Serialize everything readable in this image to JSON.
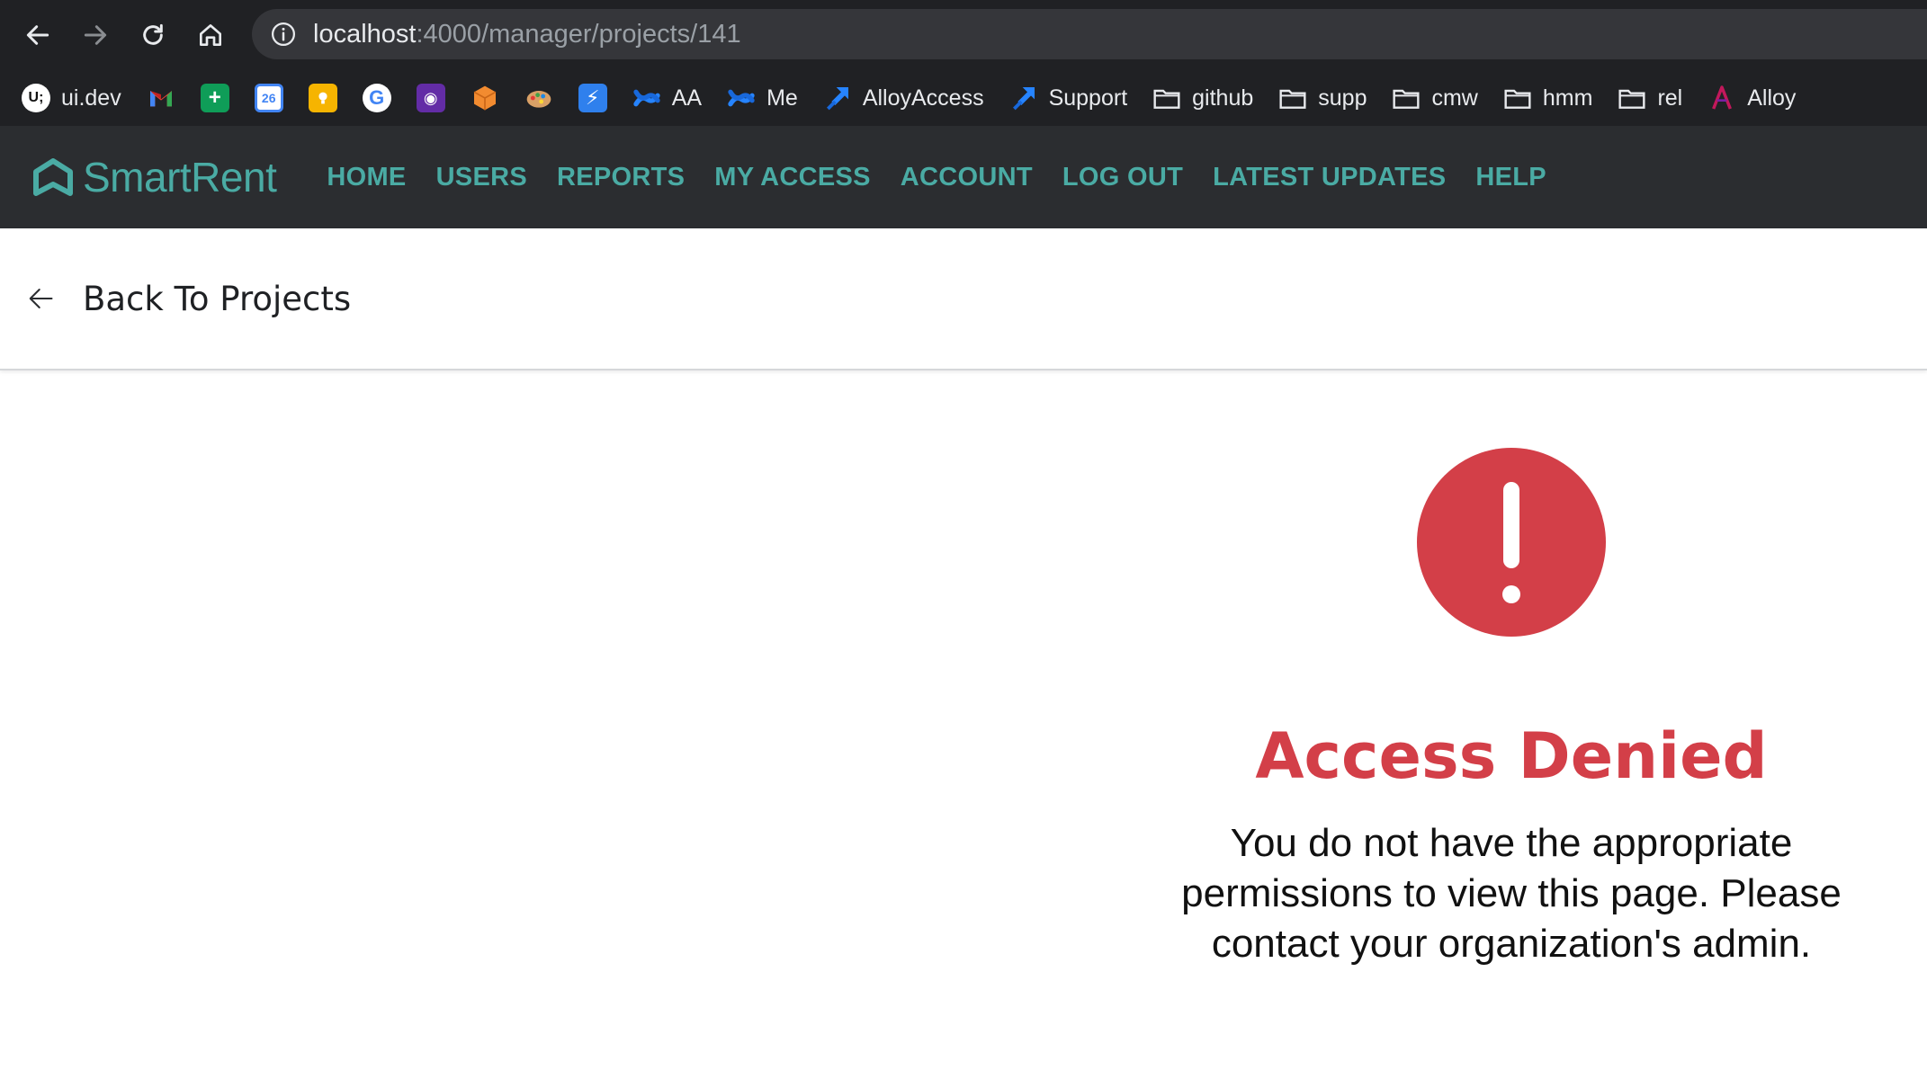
{
  "browser": {
    "url_host": "localhost",
    "url_path": ":4000/manager/projects/141",
    "bookmarks": [
      {
        "label": "ui.dev",
        "icon": "ui-dev-icon"
      },
      {
        "label": "",
        "icon": "gmail-icon"
      },
      {
        "label": "",
        "icon": "sheets-icon"
      },
      {
        "label": "",
        "icon": "calendar-icon",
        "icon_text": "26"
      },
      {
        "label": "",
        "icon": "keep-icon"
      },
      {
        "label": "",
        "icon": "google-icon"
      },
      {
        "label": "",
        "icon": "datadog-icon"
      },
      {
        "label": "",
        "icon": "box-icon"
      },
      {
        "label": "",
        "icon": "palette-icon"
      },
      {
        "label": "",
        "icon": "bolt-icon"
      },
      {
        "label": "AA",
        "icon": "confluence-icon"
      },
      {
        "label": "Me",
        "icon": "confluence-icon"
      },
      {
        "label": "AlloyAccess",
        "icon": "jira-icon"
      },
      {
        "label": "Support",
        "icon": "jira-icon"
      },
      {
        "label": "github",
        "icon": "folder-icon"
      },
      {
        "label": "supp",
        "icon": "folder-icon"
      },
      {
        "label": "cmw",
        "icon": "folder-icon"
      },
      {
        "label": "hmm",
        "icon": "folder-icon"
      },
      {
        "label": "rel",
        "icon": "folder-icon"
      },
      {
        "label": "Alloy",
        "icon": "alloy-icon"
      }
    ]
  },
  "app": {
    "logo_text": "SmartRent",
    "nav": [
      "HOME",
      "USERS",
      "REPORTS",
      "MY ACCESS",
      "ACCOUNT",
      "LOG OUT",
      "LATEST UPDATES",
      "HELP"
    ],
    "back_label": "Back To Projects",
    "error": {
      "title": "Access Denied",
      "message": "You do not have the appropriate permissions to view this page. Please contact your organization's admin."
    },
    "colors": {
      "brand": "#4aaba4",
      "navbar_bg": "#2b2d30",
      "error_red": "#d33f48"
    }
  }
}
